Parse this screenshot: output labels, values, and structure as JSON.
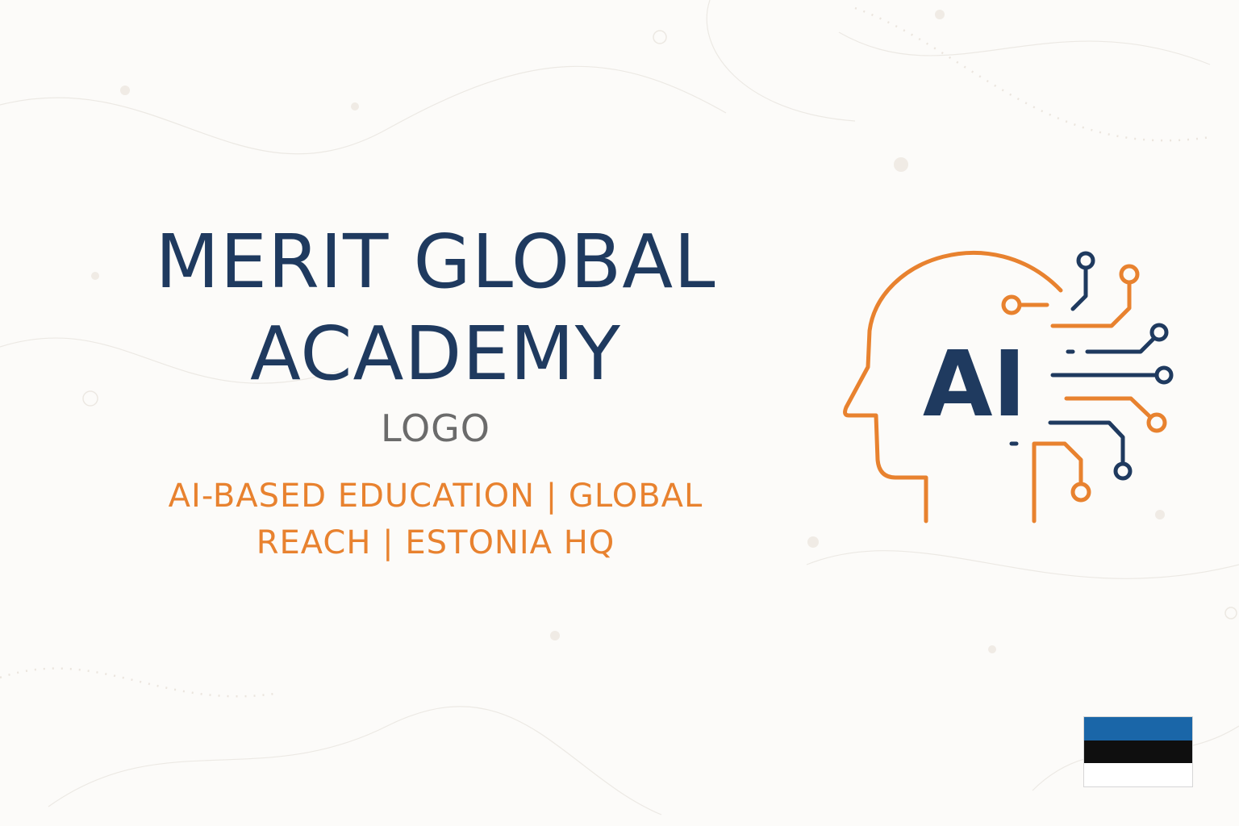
{
  "header": {
    "title_line_1": "MERIT GLOBAL",
    "title_line_2": "ACADEMY",
    "subtitle": "LOGO"
  },
  "tagline": {
    "line_1": "AI-BASED EDUCATION | GLOBAL",
    "line_2": "REACH | ESTONIA HQ"
  },
  "logo": {
    "text": "AI",
    "icon": "ai-head-circuit-icon"
  },
  "flag": {
    "icon": "estonia-flag-icon",
    "colors": [
      "#1a66a8",
      "#0f0f0f",
      "#ffffff"
    ]
  },
  "colors": {
    "navy": "#1f3a5f",
    "orange": "#e8822f",
    "gray": "#6b6b6b",
    "background": "#fcfbf9"
  }
}
